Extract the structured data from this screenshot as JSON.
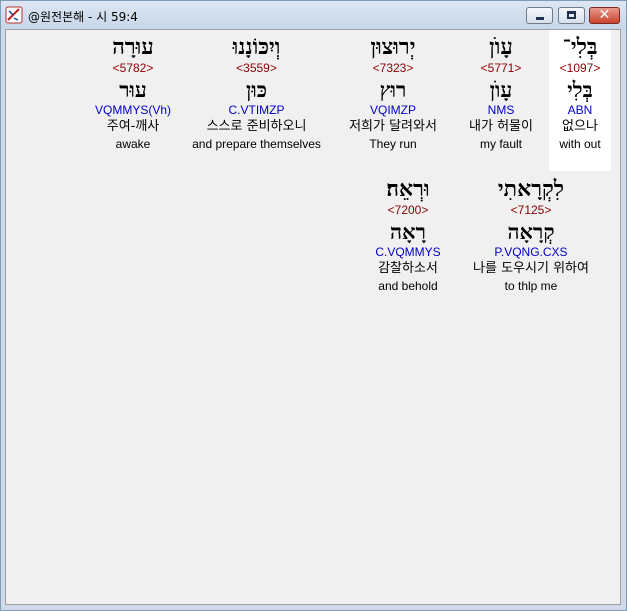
{
  "window": {
    "title": "@원전본해 - 시 59:4",
    "close_symbol": "✕"
  },
  "words": [
    {
      "hebrew": "בְּלִי־",
      "strong": "<1097>",
      "root": "בְּלִי",
      "parse": "ABN",
      "korean": "없으나",
      "english": "with out",
      "selected": true
    },
    {
      "hebrew": "עָוֺן",
      "strong": "<5771>",
      "root": "עָוֺן",
      "parse": "NMS",
      "korean": "내가 허물이",
      "english": "my fault",
      "selected": false
    },
    {
      "hebrew": "יְרוּצוּן",
      "strong": "<7323>",
      "root": "רוּץ",
      "parse": "VQIMZP",
      "korean": "저희가 달려와서",
      "english": "They run",
      "selected": false
    },
    {
      "hebrew": "וְיִכּוֹנָנוּ",
      "strong": "<3559>",
      "root": "כּוּן",
      "parse": "C.VTIMZP",
      "korean": "스스로 준비하오니",
      "english": "and prepare themselves",
      "selected": false
    },
    {
      "hebrew": "עוּרָה",
      "strong": "<5782>",
      "root": "עוּר",
      "parse": "VQMMYS(Vh)",
      "korean": "주여-깨사",
      "english": "awake",
      "selected": false
    },
    {
      "hebrew": "לִקְרָאתִי",
      "strong": "<7125>",
      "root": "קְרָאָה",
      "parse": "P.VQNG.CXS",
      "korean": "나를 도우시기 위하여",
      "english": "to thlp me",
      "selected": false
    },
    {
      "hebrew": "וּרְאֵה׃",
      "strong": "<7200>",
      "root": "רָאָה",
      "parse": "C.VQMMYS",
      "korean": "감찰하소서",
      "english": "and behold",
      "selected": false
    }
  ]
}
